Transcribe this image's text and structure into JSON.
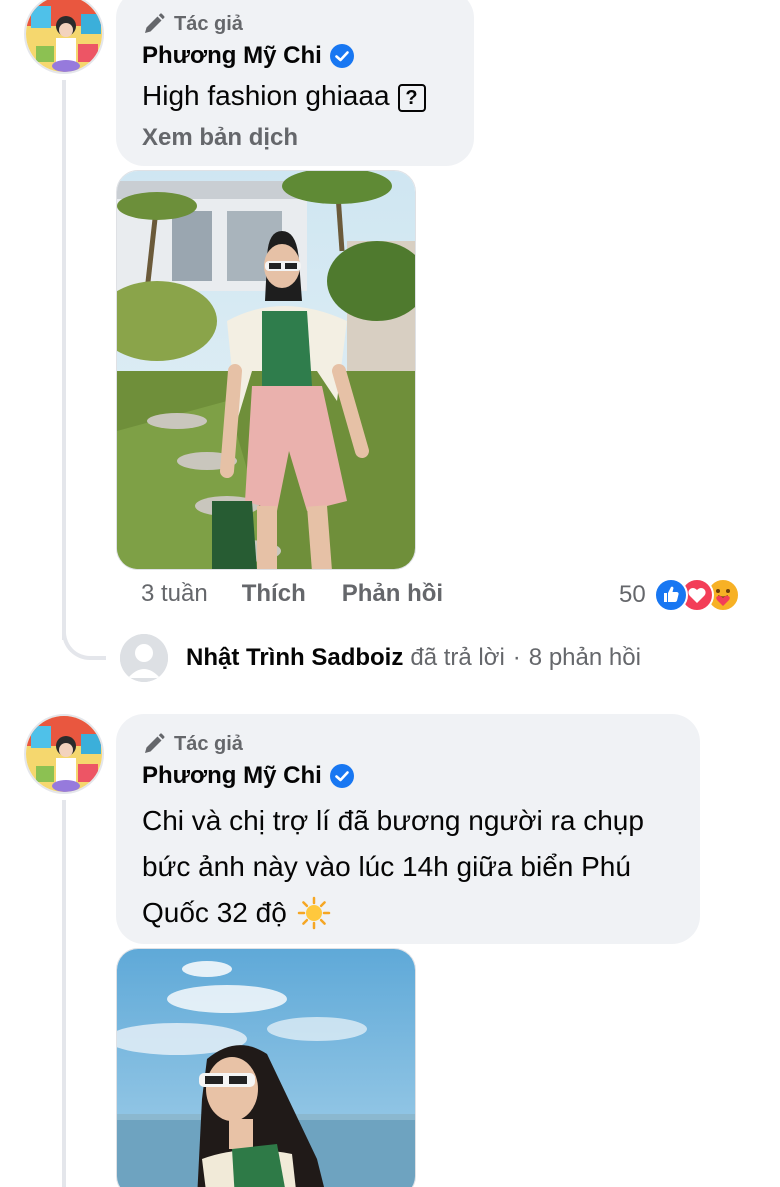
{
  "comments": [
    {
      "author_badge": "Tác giả",
      "name": "Phương Mỹ Chi",
      "text_line1": "High fashion ghiaaa",
      "unknown_glyph": "?",
      "see_translation": "Xem bản dịch",
      "time": "3 tuần",
      "like_label": "Thích",
      "reply_label": "Phản hồi",
      "reaction_count": "50",
      "reactions": [
        "like-icon",
        "love-icon",
        "care-icon"
      ]
    },
    {
      "author_badge": "Tác giả",
      "name": "Phương Mỹ Chi",
      "text_line1": "Chi và chị trợ lí đã bương người ra chụp",
      "text_line2": "bức ảnh này vào lúc 14h giữa biển Phú",
      "text_line3": "Quốc 32 độ",
      "emoji": "sun-emoji"
    }
  ],
  "reply_summary": {
    "name": "Nhật Trình Sadboiz",
    "action": "đã trả lời",
    "separator": "·",
    "count": "8 phản hồi"
  },
  "colors": {
    "bubble": "#f0f2f5",
    "verified": "#1877f2",
    "secondary_text": "#65676b",
    "like": "#1877f2",
    "love": "#f33e58",
    "care": "#f7b125"
  }
}
